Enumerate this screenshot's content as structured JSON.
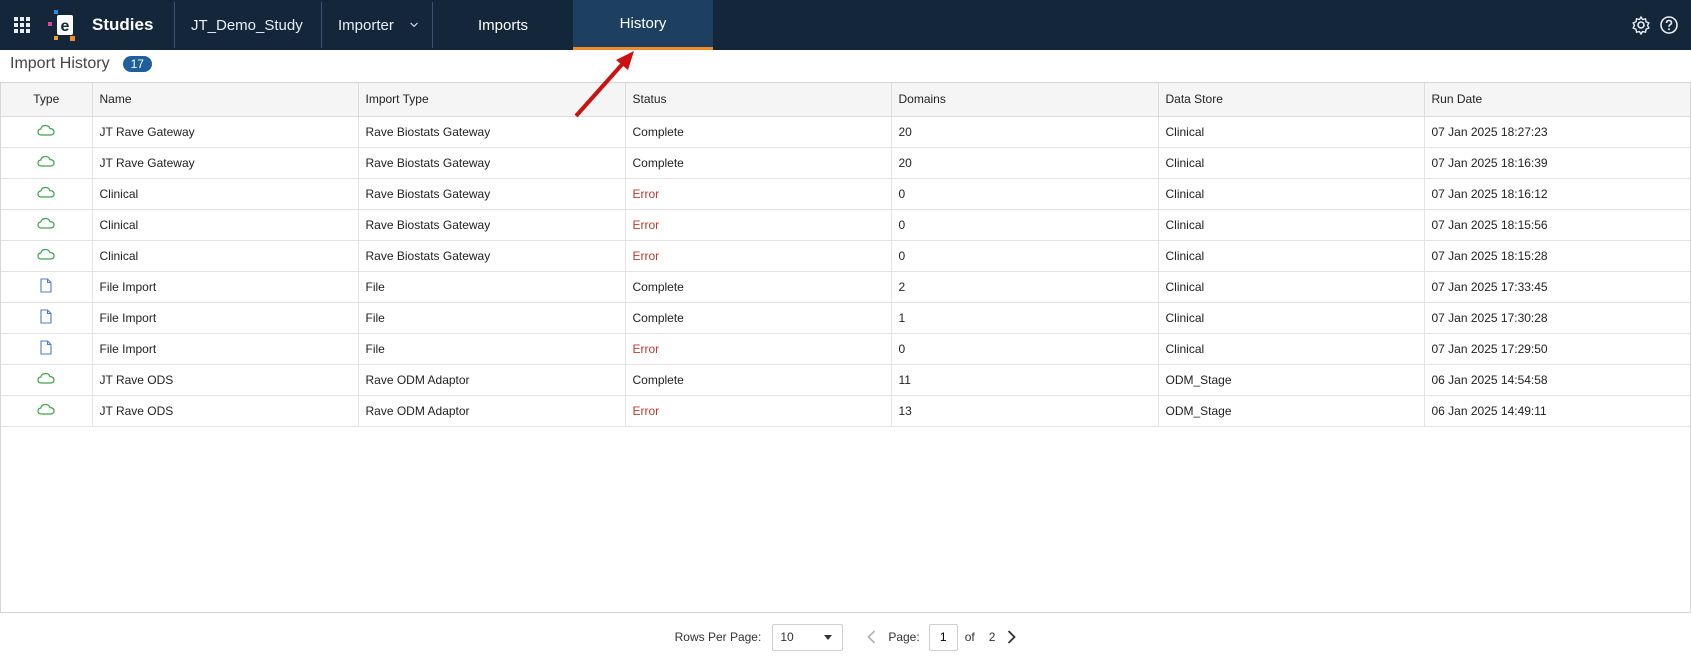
{
  "nav": {
    "brand": "Studies",
    "study_dropdown": "JT_Demo_Study",
    "module_dropdown": "Importer",
    "tabs": [
      {
        "label": "Imports",
        "active": false
      },
      {
        "label": "History",
        "active": true
      }
    ],
    "right_icons": [
      "settings-icon",
      "help-icon"
    ]
  },
  "header": {
    "title": "Import History",
    "count": "17"
  },
  "table": {
    "columns": [
      "Type",
      "Name",
      "Import Type",
      "Status",
      "Domains",
      "Data Store",
      "Run Date"
    ],
    "rows": [
      {
        "type_icon": "cloud-icon",
        "name": "JT Rave Gateway",
        "import_type": "Rave Biostats Gateway",
        "status": "Complete",
        "domains": "20",
        "data_store": "Clinical",
        "run_date": "07 Jan 2025 18:27:23"
      },
      {
        "type_icon": "cloud-icon",
        "name": "JT Rave Gateway",
        "import_type": "Rave Biostats Gateway",
        "status": "Complete",
        "domains": "20",
        "data_store": "Clinical",
        "run_date": "07 Jan 2025 18:16:39"
      },
      {
        "type_icon": "cloud-icon",
        "name": "Clinical",
        "import_type": "Rave Biostats Gateway",
        "status": "Error",
        "domains": "0",
        "data_store": "Clinical",
        "run_date": "07 Jan 2025 18:16:12"
      },
      {
        "type_icon": "cloud-icon",
        "name": "Clinical",
        "import_type": "Rave Biostats Gateway",
        "status": "Error",
        "domains": "0",
        "data_store": "Clinical",
        "run_date": "07 Jan 2025 18:15:56"
      },
      {
        "type_icon": "cloud-icon",
        "name": "Clinical",
        "import_type": "Rave Biostats Gateway",
        "status": "Error",
        "domains": "0",
        "data_store": "Clinical",
        "run_date": "07 Jan 2025 18:15:28"
      },
      {
        "type_icon": "file-icon",
        "name": "File Import",
        "import_type": "File",
        "status": "Complete",
        "domains": "2",
        "data_store": "Clinical",
        "run_date": "07 Jan 2025 17:33:45"
      },
      {
        "type_icon": "file-icon",
        "name": "File Import",
        "import_type": "File",
        "status": "Complete",
        "domains": "1",
        "data_store": "Clinical",
        "run_date": "07 Jan 2025 17:30:28"
      },
      {
        "type_icon": "file-icon",
        "name": "File Import",
        "import_type": "File",
        "status": "Error",
        "domains": "0",
        "data_store": "Clinical",
        "run_date": "07 Jan 2025 17:29:50"
      },
      {
        "type_icon": "cloud-icon",
        "name": "JT Rave ODS",
        "import_type": "Rave ODM Adaptor",
        "status": "Complete",
        "domains": "11",
        "data_store": "ODM_Stage",
        "run_date": "06 Jan 2025 14:54:58"
      },
      {
        "type_icon": "cloud-icon",
        "name": "JT Rave ODS",
        "import_type": "Rave ODM Adaptor",
        "status": "Error",
        "domains": "13",
        "data_store": "ODM_Stage",
        "run_date": "06 Jan 2025 14:49:11"
      }
    ]
  },
  "pager": {
    "rows_per_page_label": "Rows Per Page:",
    "rows_per_page_value": "10",
    "page_label": "Page:",
    "page_value": "1",
    "of_label": "of",
    "total_pages": "2"
  },
  "colors": {
    "nav_bg": "#14263a",
    "active_tab_bg": "#1d3f60",
    "active_tab_underline": "#f08a2b",
    "badge": "#1f5f9c",
    "error_text": "#c0392b",
    "cloud_icon": "#3aa64a",
    "file_icon": "#4a7fc1",
    "annotation_arrow": "#cc1111"
  }
}
